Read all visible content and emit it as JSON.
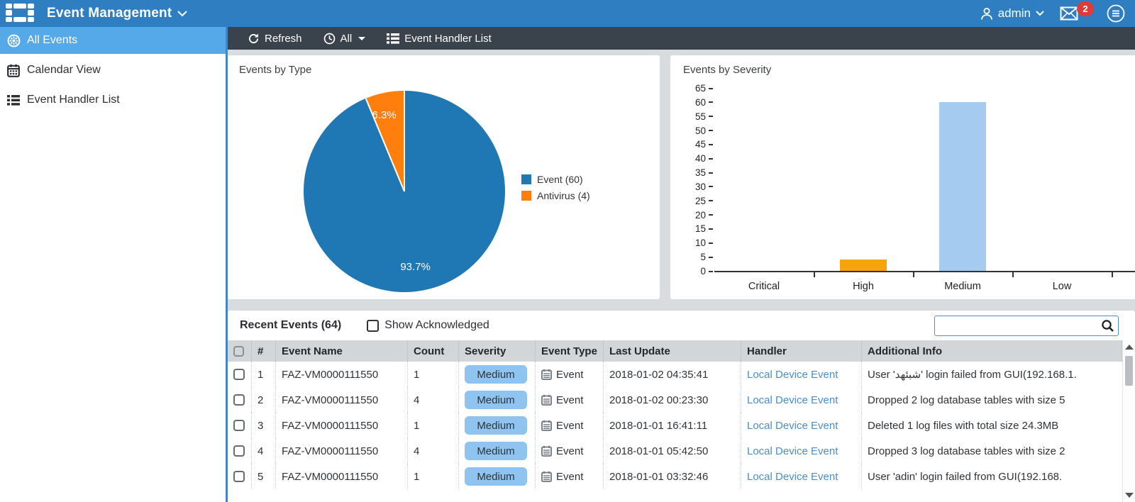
{
  "header": {
    "title": "Event Management",
    "user": "admin",
    "mail_badge": "2"
  },
  "sidebar": {
    "items": [
      {
        "label": "All Events",
        "icon": "all-events-icon",
        "selected": true
      },
      {
        "label": "Calendar View",
        "icon": "calendar-icon",
        "selected": false
      },
      {
        "label": "Event Handler List",
        "icon": "list-icon",
        "selected": false
      }
    ]
  },
  "toolbar": {
    "refresh_label": "Refresh",
    "time_filter_label": "All",
    "handler_list_label": "Event Handler List"
  },
  "colors": {
    "header_blue": "#2e7ec1",
    "selected_blue": "#55a9e8",
    "toolbar_dark": "#3a434c",
    "link_blue": "#4a8ec6",
    "badge_blue": "#8fc3f0",
    "pie_blue": "#1f77b4",
    "pie_orange": "#ff7f0e",
    "bar_blue": "#a5cbf1",
    "bar_orange": "#f7a30c",
    "badge_red": "#e03b3b"
  },
  "chart_data": [
    {
      "type": "pie",
      "title": "Events by Type",
      "labels": [
        "Event",
        "Antivirus"
      ],
      "values": [
        60,
        4
      ],
      "colors": [
        "#1f77b4",
        "#ff7f0e"
      ],
      "slice_labels": [
        "93.7%",
        "6.3%"
      ],
      "legend": [
        "Event (60)",
        "Antivirus (4)"
      ],
      "legend_position": "right"
    },
    {
      "type": "bar",
      "title": "Events by Severity",
      "categories": [
        "Critical",
        "High",
        "Medium",
        "Low"
      ],
      "values": [
        0,
        4,
        60,
        0
      ],
      "colors": [
        "#a5cbf1",
        "#f7a30c",
        "#a5cbf1",
        "#a5cbf1"
      ],
      "ylim": [
        0,
        65
      ],
      "ytick_step": 5,
      "grid": false,
      "xlabel": "",
      "ylabel": ""
    }
  ],
  "recent": {
    "title": "Recent Events (64)",
    "show_acknowledged_label": "Show Acknowledged",
    "search_value": ""
  },
  "table": {
    "columns": [
      "",
      "#",
      "Event Name",
      "Count",
      "Severity",
      "Event Type",
      "Last Update",
      "Handler",
      "Additional Info"
    ],
    "rows": [
      {
        "num": "1",
        "name": "FAZ-VM0000111550",
        "count": "1",
        "severity": "Medium",
        "type": "Event",
        "update": "2018-01-02 04:35:41",
        "handler": "Local Device Event",
        "info": "User 'شبئهد' login failed from GUI(192.168.1.",
        "bold": false
      },
      {
        "num": "2",
        "name": "FAZ-VM0000111550",
        "count": "4",
        "severity": "Medium",
        "type": "Event",
        "update": "2018-01-02 00:23:30",
        "handler": "Local Device Event",
        "info": "Dropped 2 log database tables with size 5",
        "bold": true
      },
      {
        "num": "3",
        "name": "FAZ-VM0000111550",
        "count": "1",
        "severity": "Medium",
        "type": "Event",
        "update": "2018-01-01 16:41:11",
        "handler": "Local Device Event",
        "info": "Deleted 1 log files with total size 24.3MB",
        "bold": true
      },
      {
        "num": "4",
        "name": "FAZ-VM0000111550",
        "count": "4",
        "severity": "Medium",
        "type": "Event",
        "update": "2018-01-01 05:42:50",
        "handler": "Local Device Event",
        "info": "Dropped 3 log database tables with size 2",
        "bold": true
      },
      {
        "num": "5",
        "name": "FAZ-VM0000111550",
        "count": "1",
        "severity": "Medium",
        "type": "Event",
        "update": "2018-01-01 03:32:46",
        "handler": "Local Device Event",
        "info": "User 'adin' login failed from GUI(192.168.",
        "bold": true
      }
    ]
  }
}
